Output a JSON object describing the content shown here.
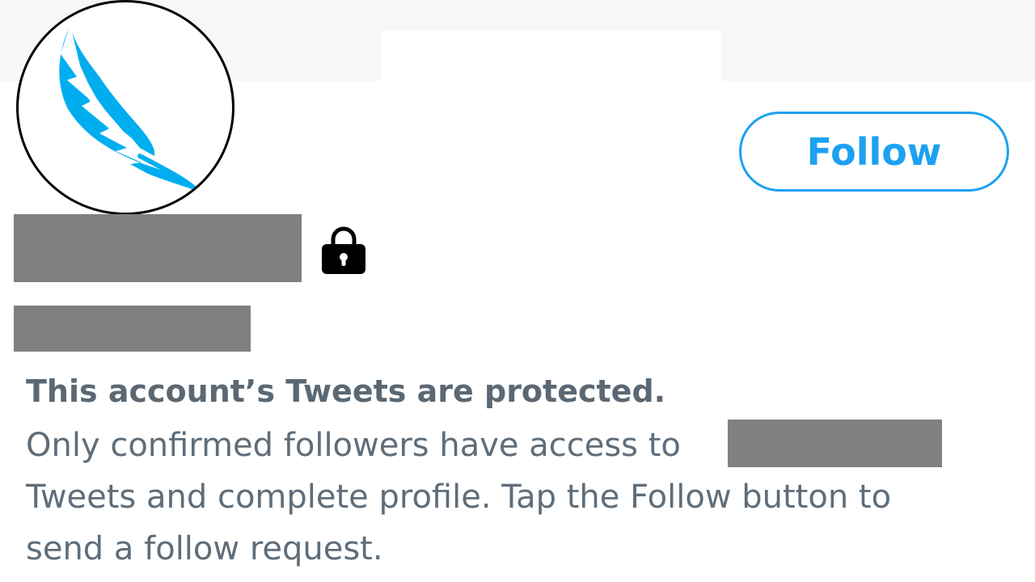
{
  "profile": {
    "avatar_icon": "feather-icon",
    "avatar_color": "#00aeef",
    "lock_icon": "lock-icon",
    "name_redacted": true,
    "handle_redacted": true
  },
  "actions": {
    "follow_label": "Follow",
    "accent_color": "#1da1f2"
  },
  "protected_notice": {
    "title": "This account’s Tweets are protected.",
    "line1": "Only confirmed followers have access to",
    "line2": "Tweets and complete profile. Tap the Follow button to",
    "line3": "send a follow request."
  }
}
